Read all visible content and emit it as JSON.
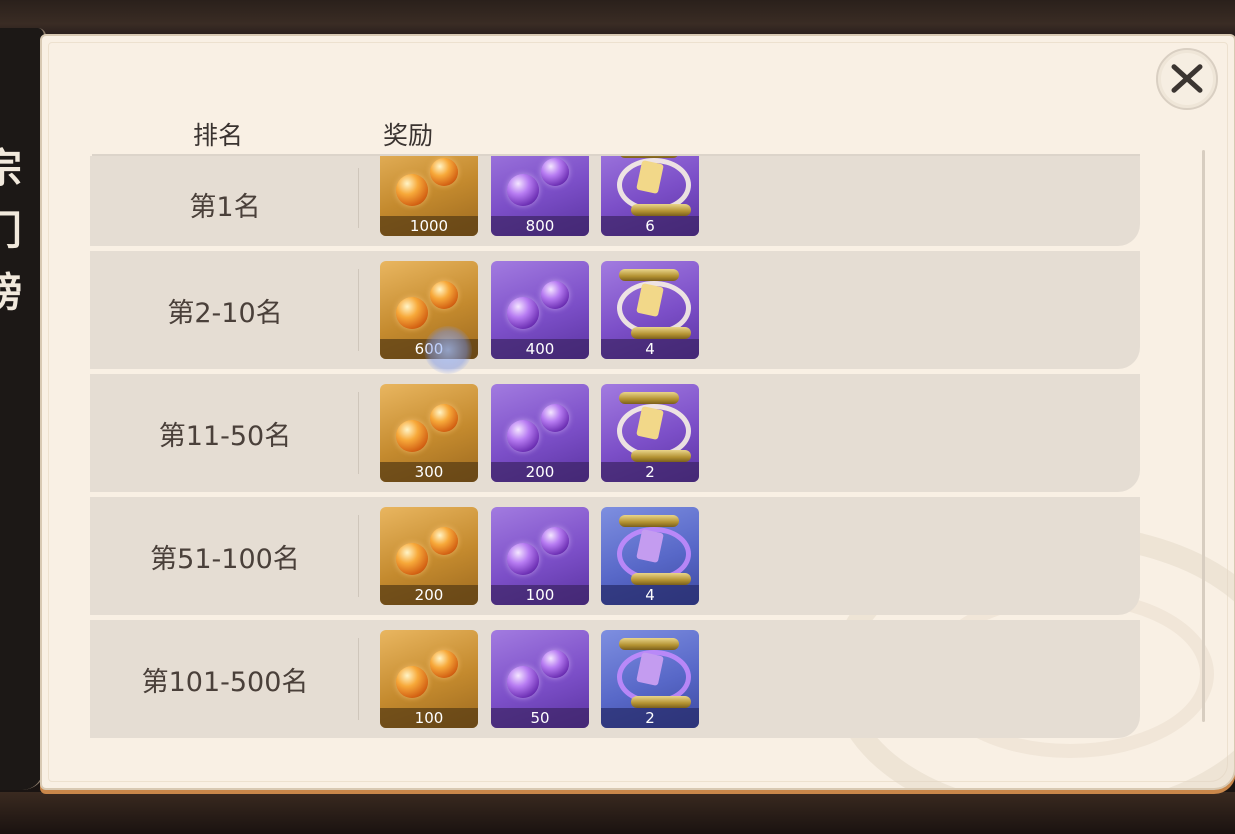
{
  "side_tab": {
    "title": "宗门榜"
  },
  "header": {
    "rank_label": "排名",
    "reward_label": "奖励"
  },
  "rows": [
    {
      "rank": "第1名",
      "rewards": [
        {
          "icon": "gold-spirit-orbs-icon",
          "count": "1000"
        },
        {
          "icon": "purple-spirit-orbs-icon",
          "count": "800"
        },
        {
          "icon": "gold-scroll-icon",
          "count": "6"
        }
      ]
    },
    {
      "rank": "第2-10名",
      "rewards": [
        {
          "icon": "gold-spirit-orbs-icon",
          "count": "600"
        },
        {
          "icon": "purple-spirit-orbs-icon",
          "count": "400"
        },
        {
          "icon": "gold-scroll-icon",
          "count": "4"
        }
      ]
    },
    {
      "rank": "第11-50名",
      "rewards": [
        {
          "icon": "gold-spirit-orbs-icon",
          "count": "300"
        },
        {
          "icon": "purple-spirit-orbs-icon",
          "count": "200"
        },
        {
          "icon": "gold-scroll-icon",
          "count": "2"
        }
      ]
    },
    {
      "rank": "第51-100名",
      "rewards": [
        {
          "icon": "gold-spirit-orbs-icon",
          "count": "200"
        },
        {
          "icon": "purple-spirit-orbs-icon",
          "count": "100"
        },
        {
          "icon": "purple-scroll-icon",
          "count": "4"
        }
      ]
    },
    {
      "rank": "第101-500名",
      "rewards": [
        {
          "icon": "gold-spirit-orbs-icon",
          "count": "100"
        },
        {
          "icon": "purple-spirit-orbs-icon",
          "count": "50"
        },
        {
          "icon": "purple-scroll-icon",
          "count": "2"
        }
      ]
    }
  ],
  "colors": {
    "panel_bg": "#f9f0e4",
    "row_bg": "#e5ddd3",
    "accent_orange": "#c9874a"
  }
}
